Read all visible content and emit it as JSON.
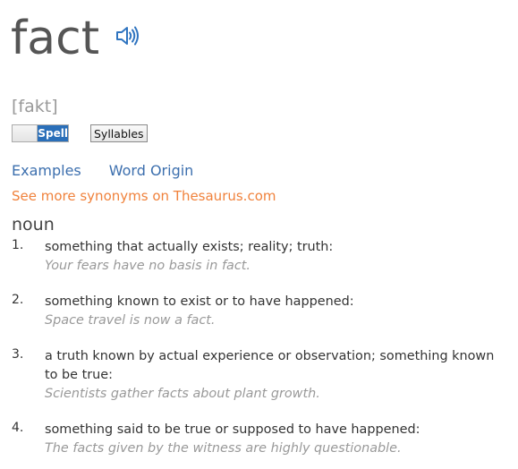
{
  "entry": {
    "headword": "fact",
    "audio_icon": "speaker-icon",
    "pronunciation": "[fakt]",
    "spell_label": "Spell",
    "syllables_label": "Syllables"
  },
  "links": {
    "examples": "Examples",
    "word_origin": "Word Origin",
    "thesaurus": "See more synonyms on Thesaurus.com"
  },
  "part_of_speech": "noun",
  "definitions": [
    {
      "num": "1.",
      "text": "something that actually exists; reality; truth:",
      "example": "Your fears have no basis in fact."
    },
    {
      "num": "2.",
      "text": "something known to exist or to have happened:",
      "example": "Space travel is now a fact."
    },
    {
      "num": "3.",
      "text": "a truth known by actual experience or observation; something known to be true:",
      "example": "Scientists gather facts about plant growth."
    },
    {
      "num": "4.",
      "text": "something said to be true or supposed to have happened:",
      "example": "The facts given by the witness are highly questionable."
    }
  ],
  "colors": {
    "link": "#3c6fae",
    "thesaurus_link": "#f0823c",
    "toggle_active": "#2a6fb9",
    "example_text": "#999999"
  }
}
